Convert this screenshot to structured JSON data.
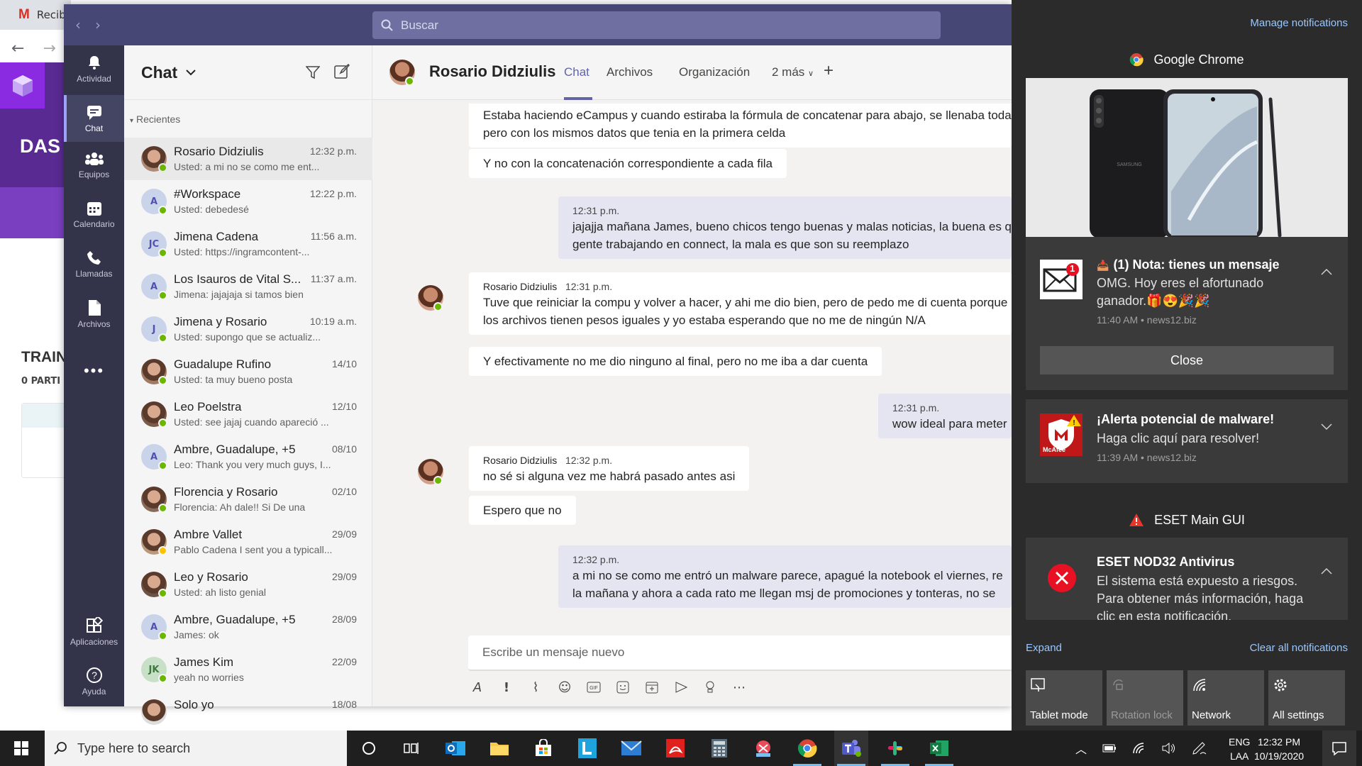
{
  "browser": {
    "tab_title": "Recib",
    "site_heading": "DAS",
    "section_heading": "TRAIN",
    "section_sub": "0 PARTI"
  },
  "teams": {
    "search_placeholder": "Buscar",
    "rail": [
      {
        "label": "Actividad",
        "icon": "bell-icon"
      },
      {
        "label": "Chat",
        "icon": "chat-icon"
      },
      {
        "label": "Equipos",
        "icon": "teams-icon"
      },
      {
        "label": "Calendario",
        "icon": "calendar-icon"
      },
      {
        "label": "Llamadas",
        "icon": "phone-icon"
      },
      {
        "label": "Archivos",
        "icon": "file-icon"
      },
      {
        "label": "Aplicaciones",
        "icon": "apps-icon"
      },
      {
        "label": "Ayuda",
        "icon": "help-icon"
      }
    ],
    "chat_list": {
      "title": "Chat",
      "section": "Recientes",
      "items": [
        {
          "name": "Rosario Didziulis",
          "preview": "Usted: a mi no se como me ent...",
          "time": "12:32 p.m.",
          "initials": ""
        },
        {
          "name": "#Workspace",
          "preview": "Usted: debedesé",
          "time": "12:22 p.m.",
          "initials": "A"
        },
        {
          "name": "Jimena Cadena",
          "preview": "Usted: https://ingramcontent-...",
          "time": "11:56 a.m.",
          "initials": "JC"
        },
        {
          "name": "Los Isauros de Vital S...",
          "preview": "Jimena: jajajaja si tamos bien",
          "time": "11:37 a.m.",
          "initials": "A"
        },
        {
          "name": "Jimena y Rosario",
          "preview": "Usted: supongo que se actualiz...",
          "time": "10:19 a.m.",
          "initials": "J"
        },
        {
          "name": "Guadalupe Rufino",
          "preview": "Usted: ta muy bueno posta",
          "time": "14/10",
          "initials": ""
        },
        {
          "name": "Leo Poelstra",
          "preview": "Usted: see jajaj cuando apareció ...",
          "time": "12/10",
          "initials": ""
        },
        {
          "name": "Ambre, Guadalupe, +5",
          "preview": "Leo: Thank you very much guys, I...",
          "time": "08/10",
          "initials": "A"
        },
        {
          "name": "Florencia y Rosario",
          "preview": "Florencia: Ah dale!! Si De una",
          "time": "02/10",
          "initials": ""
        },
        {
          "name": "Ambre Vallet",
          "preview": "Pablo Cadena I sent you a typicall...",
          "time": "29/09",
          "initials": ""
        },
        {
          "name": "Leo y Rosario",
          "preview": "Usted: ah listo genial",
          "time": "29/09",
          "initials": ""
        },
        {
          "name": "Ambre, Guadalupe, +5",
          "preview": "James: ok",
          "time": "28/09",
          "initials": "A"
        },
        {
          "name": "James Kim",
          "preview": "yeah no worries",
          "time": "22/09",
          "initials": "JK"
        },
        {
          "name": "Solo yo",
          "preview": "",
          "time": "18/08",
          "initials": ""
        }
      ]
    },
    "conversation": {
      "contact": "Rosario Didziulis",
      "tabs": [
        "Chat",
        "Archivos",
        "Organización",
        "2 más"
      ],
      "messages": {
        "m1a": "Estaba haciendo eCampus y cuando estiraba la fórmula de concatenar para abajo, se llenaba toda",
        "m1b": "pero con los mismos datos que tenia en la primera celda",
        "m2": "Y no con la concatenación correspondiente a cada fila",
        "m3_time": "12:31 p.m.",
        "m3a": "jajajja mañana James, bueno chicos tengo buenas y malas noticias, la buena es que",
        "m3b": "gente trabajando en connect, la mala es que son su reemplazo",
        "m4_sender": "Rosario Didziulis",
        "m4_time": "12:31 p.m.",
        "m4a": "Tuve que reiniciar la compu y volver a hacer, y ahi me dio bien, pero de pedo me di cuenta porque",
        "m4b": "los archivos tienen pesos iguales y yo estaba esperando que no me de ningún N/A",
        "m5": "Y efectivamente no me dio ninguno al final, pero no me iba a dar cuenta",
        "m6_time": "12:31 p.m.",
        "m6": "wow ideal para meter",
        "m7_sender": "Rosario Didziulis",
        "m7_time": "12:32 p.m.",
        "m7": "no sé si alguna vez me habrá pasado antes asi",
        "m8": "Espero que no",
        "m9_time": "12:32 p.m.",
        "m9a": "a mi no se como me entró un malware parece, apagué la notebook el viernes, re",
        "m9b": "la mañana y ahora a cada rato me llegan msj de promociones y tonteras, no se"
      },
      "composer_placeholder": "Escribe un mensaje nuevo"
    }
  },
  "action_center": {
    "manage": "Manage notifications",
    "groups": {
      "chrome": "Google Chrome",
      "eset": "ESET Main GUI"
    },
    "notif1": {
      "title": "(1) Nota: tienes un mensaje",
      "body1": "OMG. Hoy eres el afortunado",
      "body2": "ganador.🎁😍🎉🎉",
      "meta": "11:40 AM • news12.biz",
      "button": "Close",
      "badge": "1"
    },
    "notif2": {
      "title": "¡Alerta potencial de malware!",
      "body": "Haga clic aquí para resolver!",
      "meta": "11:39 AM • news12.biz",
      "logo_text": "McAfee"
    },
    "notif3": {
      "title": "ESET NOD32 Antivirus",
      "body1": "El sistema está expuesto a riesgos.",
      "body2": "Para obtener más información, haga",
      "body3": "clic en esta notificación."
    },
    "expand": "Expand",
    "clear_all": "Clear all notifications",
    "quick_actions": [
      "Tablet mode",
      "Rotation lock",
      "Network",
      "All settings"
    ],
    "phone_brand": "SAMSUNG"
  },
  "taskbar": {
    "search_placeholder": "Type here to search",
    "lang1": "ENG",
    "lang2": "LAA",
    "time": "12:32 PM",
    "date": "10/19/2020"
  }
}
